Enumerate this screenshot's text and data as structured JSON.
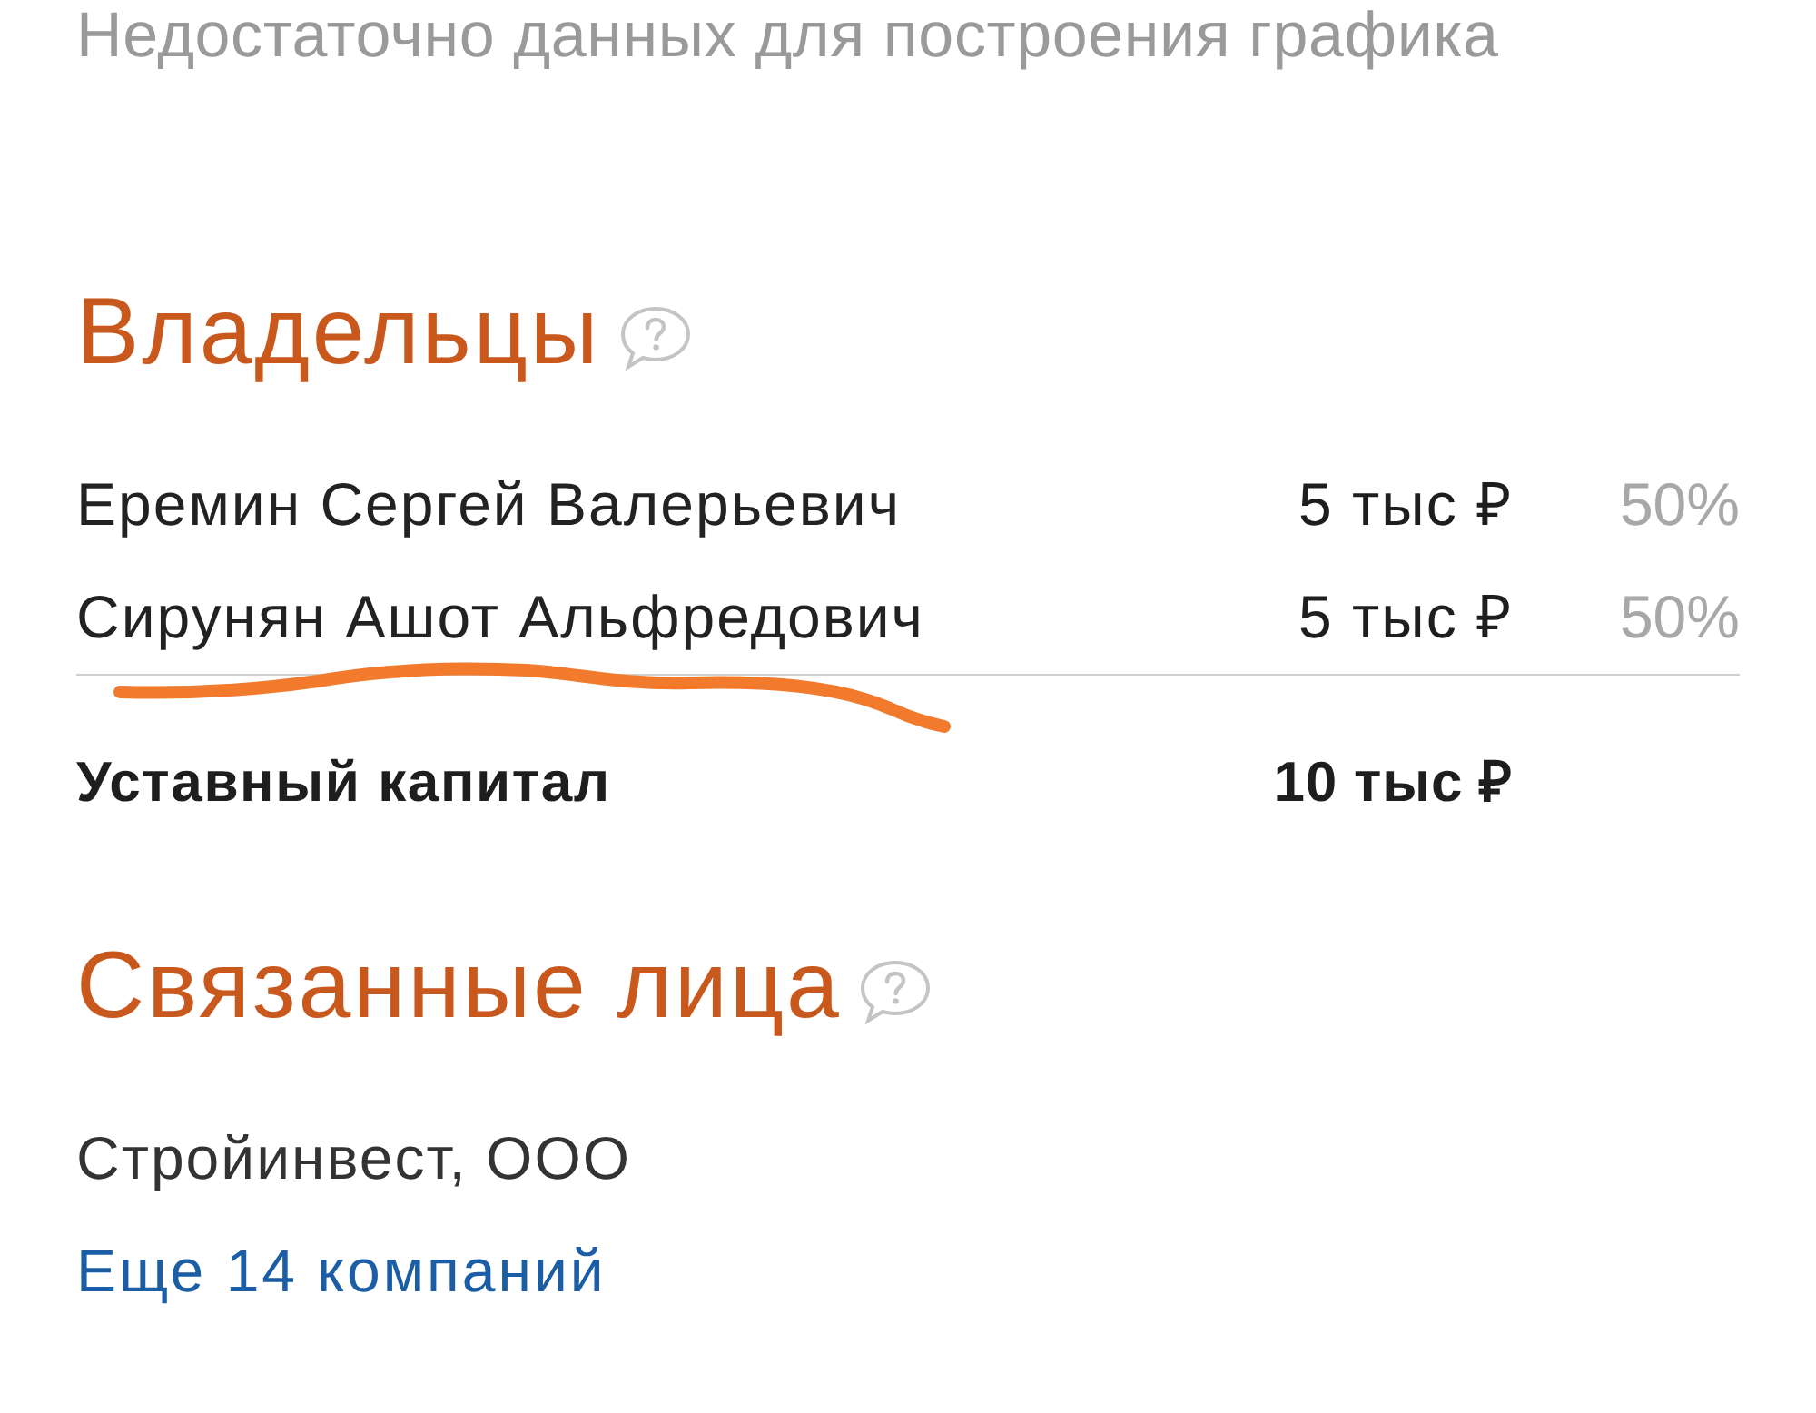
{
  "chart_notice": "Недостаточно данных для построения графика",
  "owners": {
    "title": "Владельцы",
    "rows": [
      {
        "name": "Еремин Сергей Валерьевич",
        "amount": "5 тыс ₽",
        "share": "50%"
      },
      {
        "name": "Сирунян Ашот Альфредович",
        "amount": "5 тыс ₽",
        "share": "50%"
      }
    ],
    "total": {
      "label": "Уставный капитал",
      "amount": "10 тыс ₽"
    }
  },
  "related": {
    "title": "Связанные лица",
    "items": [
      "Стройинвест, ООО"
    ],
    "more_link": "Еще 14 компаний"
  }
}
